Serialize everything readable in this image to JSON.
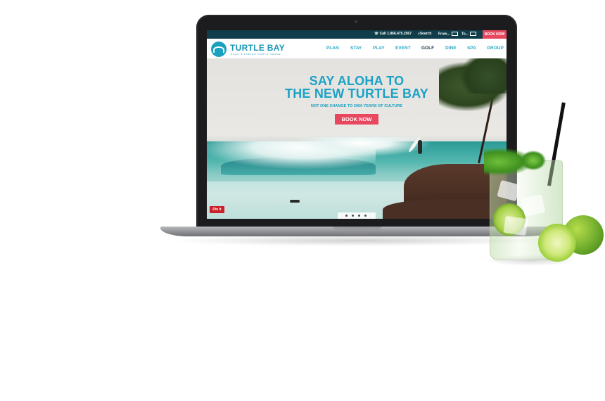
{
  "topbar": {
    "call": "Call 1.866.475.2567",
    "search": "Search",
    "from": "From...",
    "to": "To...",
    "book": "BOOK NOW"
  },
  "logo": {
    "name": "TURTLE BAY",
    "tagline": "OAHU'S FABLED NORTH SHORE"
  },
  "nav": {
    "items": [
      "PLAN",
      "STAY",
      "PLAY",
      "EVENT",
      "GOLF",
      "DINE",
      "SPA",
      "GROUP"
    ],
    "active": "GOLF"
  },
  "hero": {
    "title_line1": "SAY ALOHA TO",
    "title_line2": "THE NEW TURTLE BAY",
    "subtitle": "NOT ONE CHANGE TO 2000 YEARS OF CULTURE",
    "cta": "BOOK NOW",
    "pinit": "Pin it"
  },
  "carousel": {
    "slide_count": 4,
    "active_index": 2
  },
  "device": {
    "brand": "MacBook"
  },
  "colors": {
    "accent": "#1ba2c6",
    "cta": "#e8485f",
    "topbar": "#0f3e4a"
  }
}
